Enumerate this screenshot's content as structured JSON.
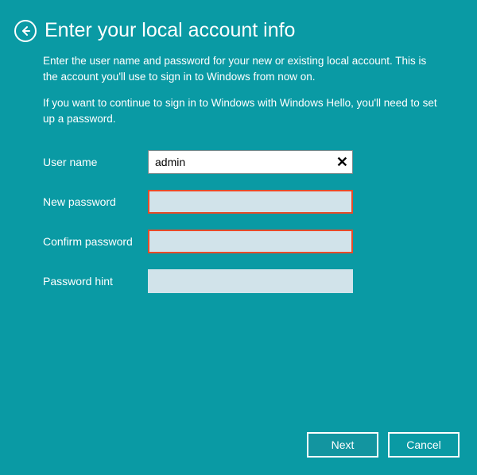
{
  "header": {
    "title": "Enter your local account info"
  },
  "description": {
    "para1": "Enter the user name and password for your new or existing local account. This is the account you'll use to sign in to Windows from now on.",
    "para2": "If you want to continue to sign in to Windows with Windows Hello, you'll need to set up a password."
  },
  "form": {
    "username_label": "User name",
    "username_value": "admin",
    "newpassword_label": "New password",
    "newpassword_value": "",
    "confirmpassword_label": "Confirm password",
    "confirmpassword_value": "",
    "hint_label": "Password hint",
    "hint_value": ""
  },
  "buttons": {
    "next": "Next",
    "cancel": "Cancel"
  },
  "icons": {
    "clear": "✕"
  }
}
